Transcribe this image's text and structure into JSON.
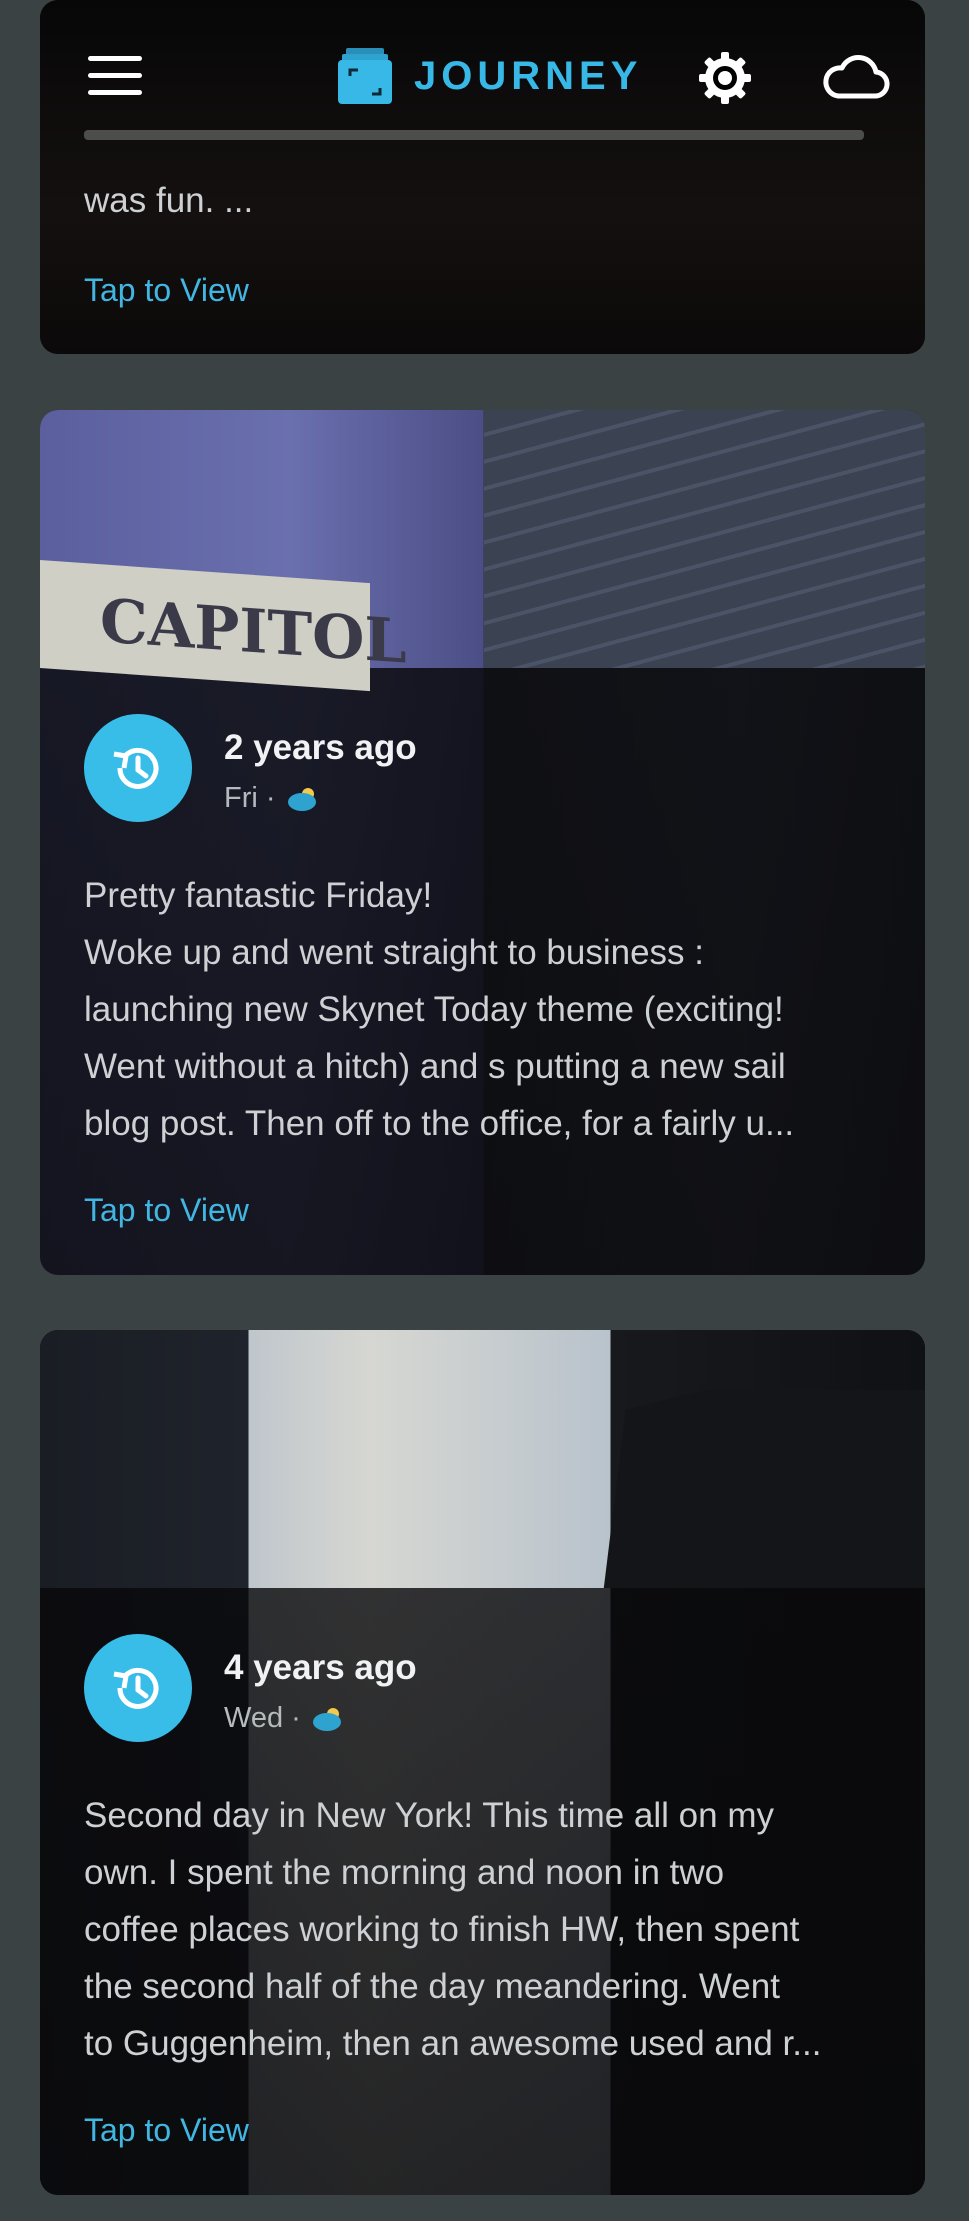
{
  "app": {
    "name": "JOURNEY"
  },
  "icons": {
    "menu": "hamburger-icon",
    "logo": "journey-logo-icon",
    "settings": "gear-icon",
    "sync": "cloud-icon",
    "history": "history-icon",
    "weather": "partly-cloudy-icon"
  },
  "colors": {
    "accent": "#37b8e6",
    "background": "#3b4244",
    "card": "#0b0b0b"
  },
  "entries": [
    {
      "partial_text": "was fun. ...",
      "tap_label": "Tap to View"
    },
    {
      "ago": "2 years ago",
      "day": "Fri",
      "sep": "·",
      "text_lines": [
        "Pretty fantastic Friday!",
        "Woke up and went straight to business :",
        "launching new Skynet Today theme (exciting!",
        "Went without a hitch) and s putting a new sail",
        "blog post. Then off to the office, for a fairly u..."
      ],
      "tap_label": "Tap to View"
    },
    {
      "ago": "4 years ago",
      "day": "Wed",
      "sep": "·",
      "text_lines": [
        "Second day in New York! This time all on my",
        "own. I spent the morning and noon in two",
        "coffee places working to finish HW, then spent",
        "the second half of the day meandering. Went",
        "to Guggenheim, then an awesome used and r..."
      ],
      "tap_label": "Tap to View"
    }
  ]
}
